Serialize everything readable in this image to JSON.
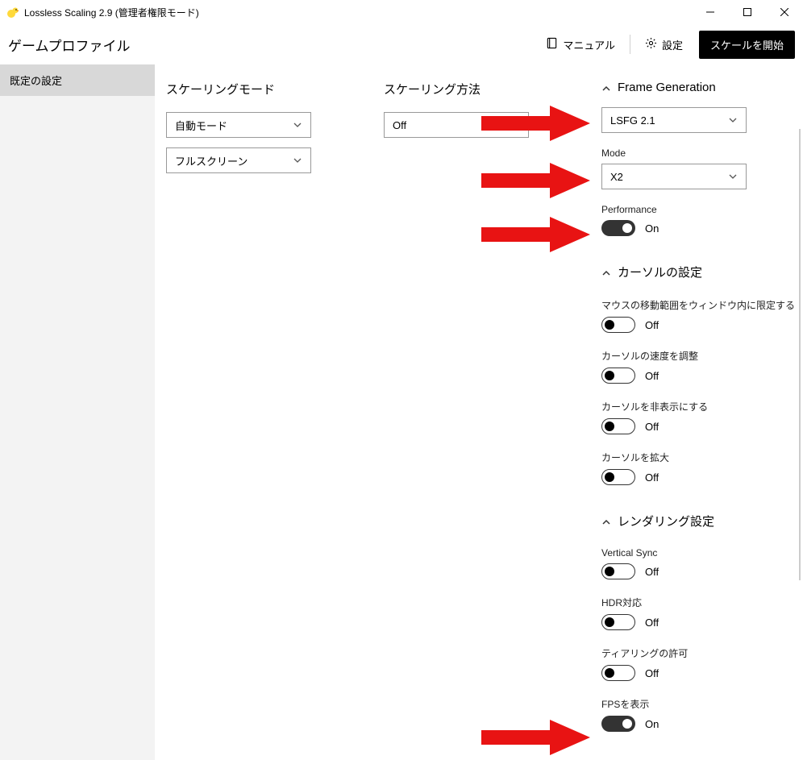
{
  "titlebar": {
    "title": "Lossless Scaling 2.9 (管理者権限モード)"
  },
  "toolbar": {
    "heading": "ゲームプロファイル",
    "manual": "マニュアル",
    "settings": "設定",
    "scale_start": "スケールを開始"
  },
  "sidebar": {
    "items": [
      {
        "label": "既定の設定"
      }
    ]
  },
  "col1": {
    "title": "スケーリングモード",
    "combo1": "自動モード",
    "combo2": "フルスクリーン"
  },
  "col2": {
    "title": "スケーリング方法",
    "combo1": "Off"
  },
  "col3": {
    "frame_gen": {
      "title": "Frame Generation",
      "combo": "LSFG 2.1",
      "mode_label": "Mode",
      "mode_value": "X2",
      "perf_label": "Performance",
      "perf_state": "On"
    },
    "cursor": {
      "title": "カーソルの設定",
      "opt1_label": "マウスの移動範囲をウィンドウ内に限定する",
      "opt1_state": "Off",
      "opt2_label": "カーソルの速度を調整",
      "opt2_state": "Off",
      "opt3_label": "カーソルを非表示にする",
      "opt3_state": "Off",
      "opt4_label": "カーソルを拡大",
      "opt4_state": "Off"
    },
    "rendering": {
      "title": "レンダリング設定",
      "vsync_label": "Vertical Sync",
      "vsync_state": "Off",
      "hdr_label": "HDR対応",
      "hdr_state": "Off",
      "tearing_label": "ティアリングの許可",
      "tearing_state": "Off",
      "fps_label": "FPSを表示",
      "fps_state": "On"
    }
  }
}
